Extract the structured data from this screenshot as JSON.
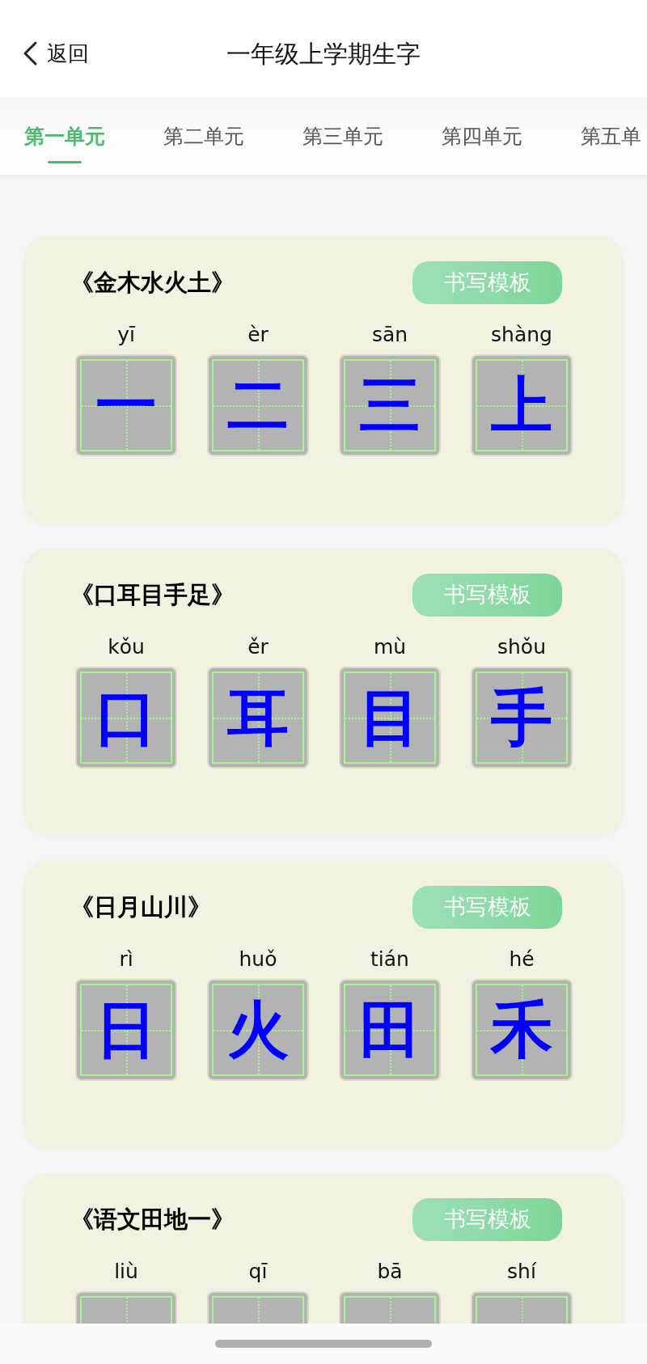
{
  "header": {
    "back_label": "返回",
    "title": "一年级上学期生字"
  },
  "tabs": [
    {
      "label": "第一单元",
      "selected": true
    },
    {
      "label": "第二单元",
      "selected": false
    },
    {
      "label": "第三单元",
      "selected": false
    },
    {
      "label": "第四单元",
      "selected": false
    },
    {
      "label": "第五单",
      "selected": false
    }
  ],
  "lessons": [
    {
      "title": "《金木水火土》",
      "button": "书写模板",
      "characters": [
        {
          "pinyin": "yī",
          "char": "一"
        },
        {
          "pinyin": "èr",
          "char": "二"
        },
        {
          "pinyin": "sān",
          "char": "三"
        },
        {
          "pinyin": "shàng",
          "char": "上"
        }
      ]
    },
    {
      "title": "《口耳目手足》",
      "button": "书写模板",
      "characters": [
        {
          "pinyin": "kǒu",
          "char": "口"
        },
        {
          "pinyin": "ěr",
          "char": "耳"
        },
        {
          "pinyin": "mù",
          "char": "目"
        },
        {
          "pinyin": "shǒu",
          "char": "手"
        }
      ]
    },
    {
      "title": "《日月山川》",
      "button": "书写模板",
      "characters": [
        {
          "pinyin": "rì",
          "char": "日"
        },
        {
          "pinyin": "huǒ",
          "char": "火"
        },
        {
          "pinyin": "tián",
          "char": "田"
        },
        {
          "pinyin": "hé",
          "char": "禾"
        }
      ]
    },
    {
      "title": "《语文田地一》",
      "button": "书写模板",
      "characters": [
        {
          "pinyin": "liù"
        },
        {
          "pinyin": "qī"
        },
        {
          "pinyin": "bā"
        },
        {
          "pinyin": "shí"
        }
      ]
    }
  ]
}
